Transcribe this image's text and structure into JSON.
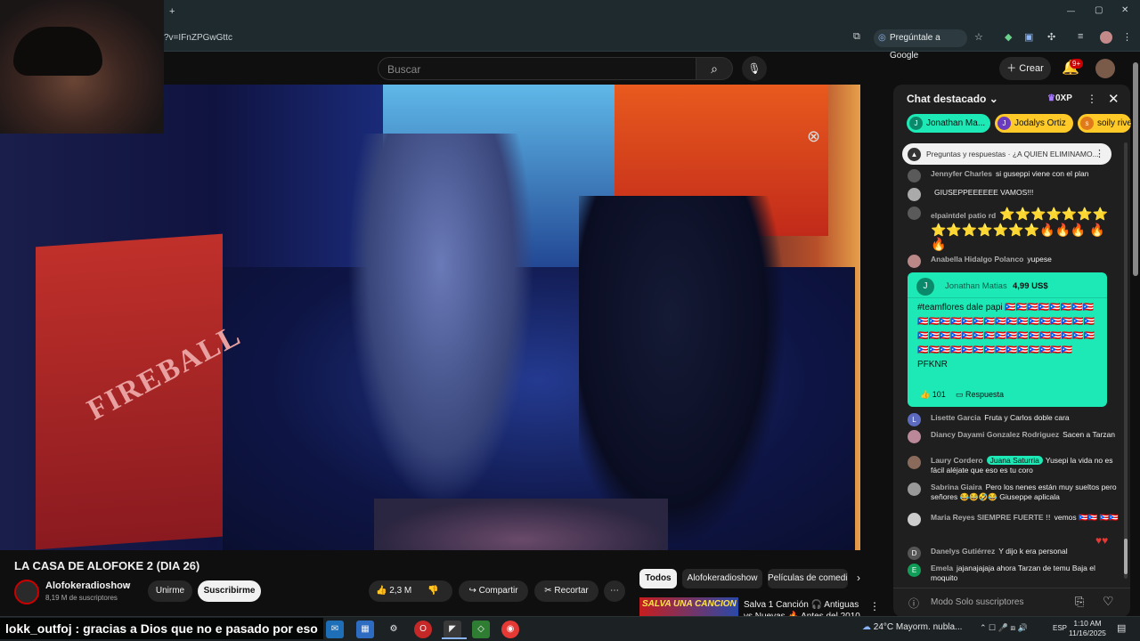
{
  "browser": {
    "new_tab": "+",
    "url": "?v=IFnZPGwGttc",
    "google_pill": "Pregúntale a Google",
    "win_min": "—",
    "win_max": "▢",
    "win_close": "✕"
  },
  "header": {
    "search_placeholder": "Buscar",
    "create_label": "Crear",
    "notif_badge": "9+"
  },
  "video": {
    "title": "LA CASA DE ALOFOKE 2 (DIA 26)",
    "scene_sign": "FIREBALL",
    "caption": "lokk_outfoj : gracias a Dios que no e pasado por eso"
  },
  "channel": {
    "name": "Alofokeradioshow",
    "subscribers": "8,19 M de suscriptores",
    "join_label": "Unirme",
    "subscribe_label": "Suscribirme"
  },
  "actions": {
    "likes": "2,3 M",
    "share_label": "Compartir",
    "clip_label": "Recortar"
  },
  "chips": [
    "Todos",
    "Alofokeradioshow",
    "Películas de comedia"
  ],
  "recommendation": {
    "thumb_text": "SALVA UNA CANCION",
    "title": "Salva 1 Canción 🎧 Antiguas vs Nuevas 🔥 Antes del 2010 vs"
  },
  "chat": {
    "title": "Chat destacado",
    "xp": "0XP",
    "donors": [
      {
        "initial": "J",
        "name": "Jonathan Ma...",
        "color": "#1de9b6"
      },
      {
        "initial": "J",
        "name": "Jodalys Ortiz",
        "color": "#ffca28"
      },
      {
        "initial": "s",
        "name": "soily rivera",
        "color": "#ffca28"
      }
    ],
    "pinned": "Preguntas y respuestas · ¿A QUIEN ELIMINAMO...",
    "messages_top": [
      {
        "author": "Jennyfer Charles",
        "text": "si guseppi viene con el plan"
      },
      {
        "author": "",
        "text": "GIUSEPPEEEEEE VAMOS!!!"
      },
      {
        "author": "elpaintdel patio rd",
        "text": "⭐⭐⭐⭐⭐⭐⭐ ⭐⭐⭐⭐⭐⭐⭐🔥🔥🔥 🔥🔥"
      },
      {
        "author": "Anabella Hidalgo Polanco",
        "text": "yupese"
      }
    ],
    "superchat": {
      "initial": "J",
      "name": "Jonathan Matias",
      "amount": "4,99 US$",
      "body": "#teamflores dale papi 🇵🇷🇵🇷🇵🇷🇵🇷🇵🇷🇵🇷🇵🇷🇵🇷🇵🇷🇵🇷🇵🇷🇵🇷🇵🇷🇵🇷🇵🇷🇵🇷🇵🇷🇵🇷🇵🇷🇵🇷🇵🇷🇵🇷🇵🇷🇵🇷🇵🇷🇵🇷🇵🇷🇵🇷🇵🇷🇵🇷🇵🇷🇵🇷🇵🇷🇵🇷🇵🇷🇵🇷🇵🇷🇵🇷🇵🇷🇵🇷🇵🇷🇵🇷🇵🇷🇵🇷🇵🇷🇵🇷🇵🇷🇵🇷🇵🇷🇵🇷🇵🇷🇵🇷🇵🇷🇵🇷 PFKNR",
      "likes": "101",
      "reply_label": "Respuesta"
    },
    "messages_bottom": [
      {
        "initial": "L",
        "author": "Lisette Garcia",
        "text": "Fruta y Carlos doble cara"
      },
      {
        "initial": "",
        "author": "Diancy Dayami Gonzalez Rodriguez",
        "text": "Sacen a Tarzan"
      },
      {
        "initial": "",
        "author": "Laury Cordero",
        "badge": "Juana Saturria",
        "text": "Yusepi la vida no es fácil aléjate que eso es tu coro"
      },
      {
        "initial": "",
        "author": "Sabrina Giaira",
        "text": "Pero los nenes están muy sueltos pero señores 😂😂🤣😂 Giuseppe aplicala"
      },
      {
        "initial": "",
        "author": "Maria Reyes SIEMPRE FUERTE !!",
        "text": "vemos 🇵🇷🇵🇷 🇵🇷🇵🇷"
      },
      {
        "initial": "D",
        "author": "Danelys Gutiérrez",
        "text": "Y dijo k era personal"
      },
      {
        "initial": "E",
        "author": "Emela",
        "text": "jajanajajaja ahora Tarzan de temu Baja el moquito"
      }
    ],
    "input_placeholder": "Modo Solo suscriptores"
  },
  "taskbar": {
    "weather": "24°C   Mayorm. nubla...",
    "lang": "ESP",
    "time": "1:10 AM",
    "date": "11/16/2025"
  },
  "colors": {
    "accent_red": "#cc0000",
    "superchat_green": "#1de9b6",
    "donor_yellow": "#ffca28"
  }
}
